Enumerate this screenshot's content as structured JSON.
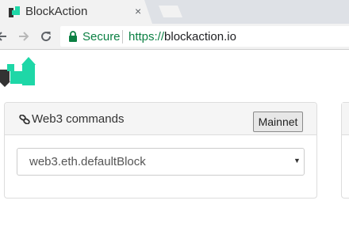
{
  "browser": {
    "tab": {
      "title": "BlockAction",
      "close_symbol": "×",
      "favicon": "blockaction-favicon"
    },
    "security_label": "Secure",
    "url": {
      "scheme": "https://",
      "host": "blockaction.io"
    },
    "colors": {
      "secure_green": "#0b8043",
      "tab_strip": "#dee1e6",
      "toolbar": "#f2f2f2"
    }
  },
  "page": {
    "logo": "blockaction-logo",
    "logo_colors": {
      "dark": "#333333",
      "teal": "#1ed7a7"
    },
    "panel": {
      "title": "Web3 commands",
      "title_icon": "link-icon",
      "network_button": "Mainnet",
      "command_select": {
        "selected": "web3.eth.defaultBlock"
      }
    }
  }
}
